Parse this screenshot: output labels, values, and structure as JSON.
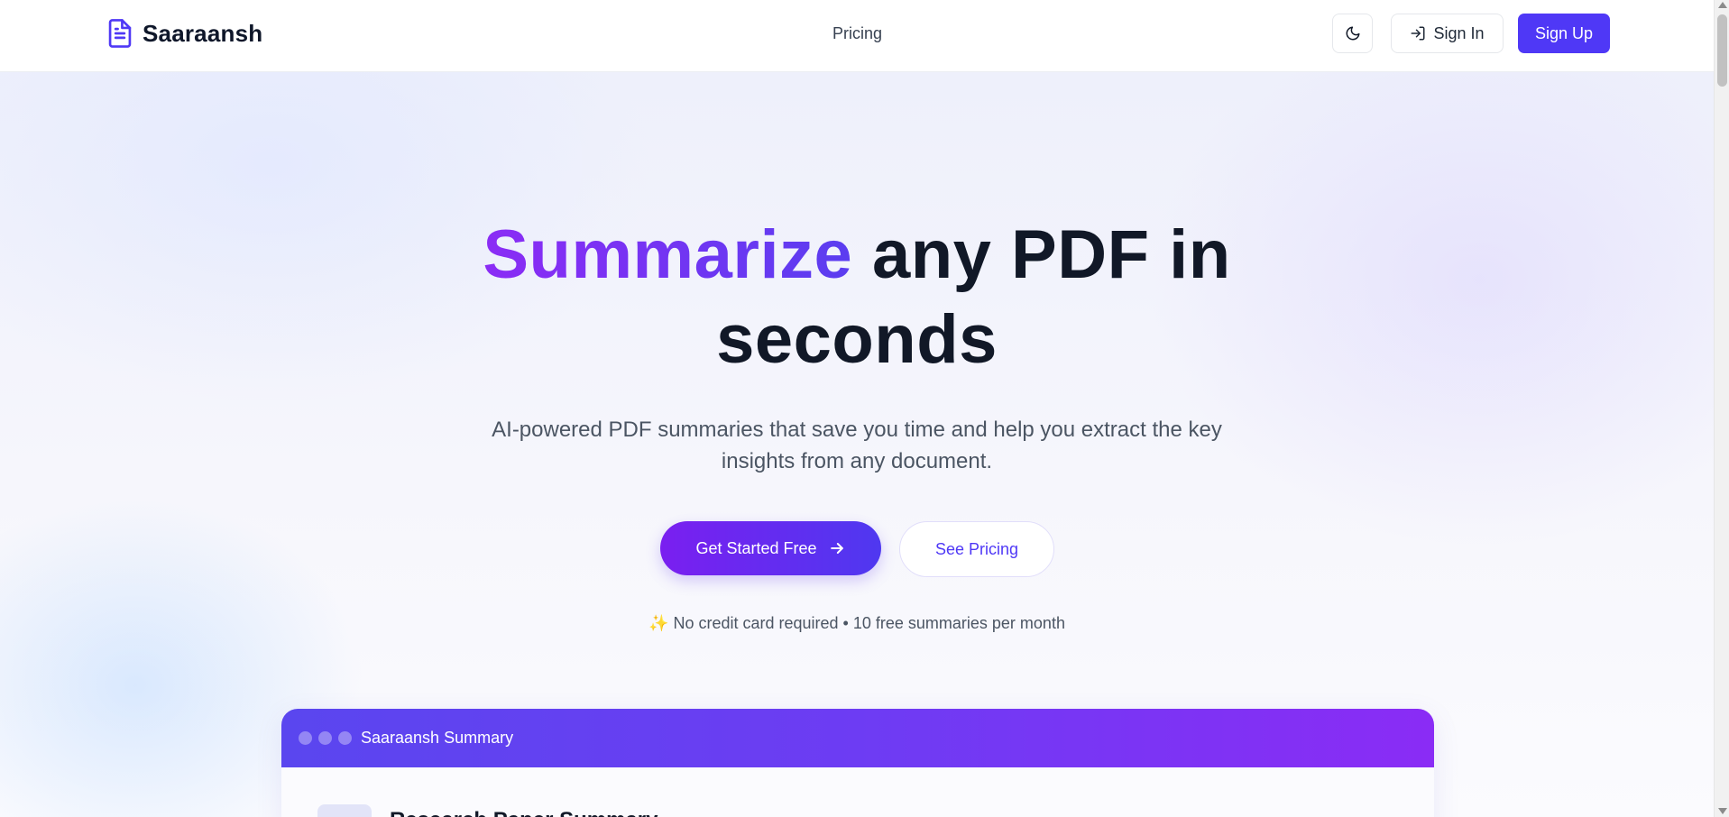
{
  "header": {
    "brand": "Saaraansh",
    "nav_pricing": "Pricing",
    "theme_icon": "moon-icon",
    "sign_in": "Sign In",
    "sign_up": "Sign Up"
  },
  "hero": {
    "title_accent": "Summarize",
    "title_rest_line1": " any PDF in",
    "title_line2": "seconds",
    "subtitle": "AI-powered PDF summaries that save you time and help you extract the key insights from any document.",
    "cta_primary": "Get Started Free",
    "cta_secondary": "See Pricing",
    "note_emoji": "✨",
    "note": "No credit card required • 10 free summaries per month"
  },
  "preview": {
    "window_title": "Saaraansh Summary",
    "heading": "Research Paper Summary"
  },
  "colors": {
    "brand": "#4f38f6",
    "accent_start": "#8b2cf5",
    "accent_end": "#5b3df0"
  }
}
